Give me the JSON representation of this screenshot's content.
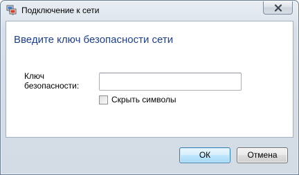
{
  "window": {
    "title": "Подключение к сети",
    "title_icon": "network-connection-icon",
    "close_icon": "close-icon"
  },
  "dialog": {
    "heading": "Введите ключ безопасности сети",
    "key_label": "Ключ безопасности:",
    "key_value": "",
    "hide_symbols_label": "Скрыть символы",
    "hide_symbols_checked": false,
    "heading_color": "#1e3f8f"
  },
  "buttons": {
    "ok_label": "ОК",
    "cancel_label": "Отмена"
  }
}
